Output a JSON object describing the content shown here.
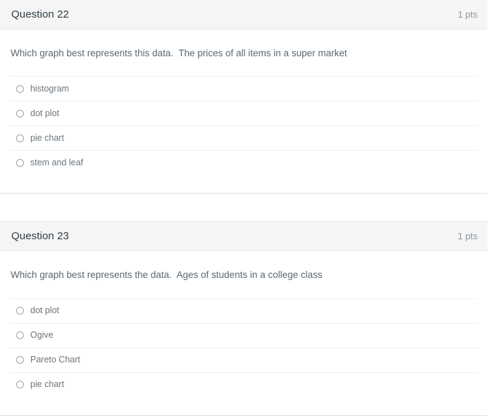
{
  "questions": [
    {
      "name": "Question 22",
      "points": "1 pts",
      "text": "Which graph best represents this data.  The prices of all items in a super market",
      "options": [
        {
          "label": "histogram"
        },
        {
          "label": "dot plot"
        },
        {
          "label": "pie chart"
        },
        {
          "label": "stem and leaf"
        }
      ]
    },
    {
      "name": "Question 23",
      "points": "1 pts",
      "text": "Which graph best represents the data.  Ages of students in a college class",
      "options": [
        {
          "label": "dot plot"
        },
        {
          "label": "Ogive"
        },
        {
          "label": "Pareto Chart"
        },
        {
          "label": "pie chart"
        }
      ]
    }
  ],
  "colors": {
    "header_background": "#f5f5f5",
    "header_title": "#2d3b45",
    "points_text": "#8b969e",
    "question_text": "#5b6770",
    "option_text": "#6b757d",
    "divider": "#eceff1",
    "radio_border": "#9aa3a9"
  }
}
